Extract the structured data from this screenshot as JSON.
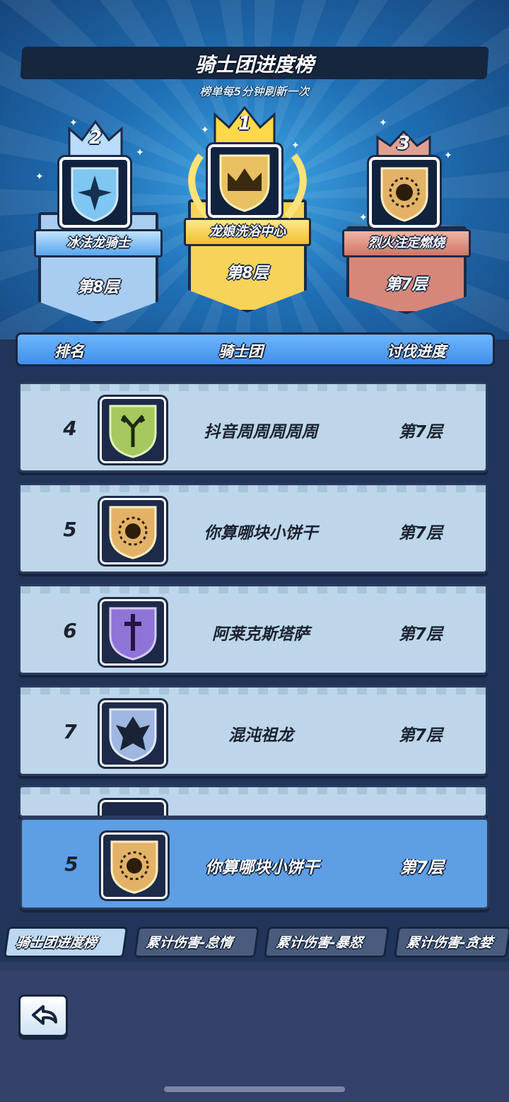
{
  "header": {
    "title": "骑士团进度榜",
    "subtitle": "榜单每5分钟刷新一次"
  },
  "podium": [
    {
      "rank": "2",
      "name": "冰法龙骑士",
      "floor": "第8层",
      "crest": "ice-star-crest-icon",
      "color": "#6aaef0"
    },
    {
      "rank": "1",
      "name": "龙娘洗浴中心",
      "floor": "第8层",
      "crest": "crown-crest-icon",
      "color": "#f6cf4e"
    },
    {
      "rank": "3",
      "name": "烈火注定燃烧",
      "floor": "第7层",
      "crest": "sun-crest-icon",
      "color": "#d8887a"
    }
  ],
  "table": {
    "columns": [
      "排名",
      "骑士团",
      "讨伐进度"
    ],
    "rows": [
      {
        "rank": "4",
        "name": "抖音周周周周周",
        "progress": "第7层",
        "crest": "stag-crest-icon"
      },
      {
        "rank": "5",
        "name": "你算哪块小饼干",
        "progress": "第7层",
        "crest": "sun-crest-icon"
      },
      {
        "rank": "6",
        "name": "阿莱克斯塔萨",
        "progress": "第7层",
        "crest": "sword-crest-icon"
      },
      {
        "rank": "7",
        "name": "混沌祖龙",
        "progress": "第7层",
        "crest": "dragon-crest-icon"
      }
    ],
    "my_row": {
      "rank": "5",
      "name": "你算哪块小饼干",
      "progress": "第7层",
      "crest": "sun-crest-icon"
    }
  },
  "tabs": [
    {
      "label": "骑士团进度榜",
      "active": true
    },
    {
      "label": "累计伤害-怠惰",
      "active": false
    },
    {
      "label": "累计伤害-暴怒",
      "active": false
    },
    {
      "label": "累计伤害-贪婪",
      "active": false
    }
  ],
  "footer": {
    "back_icon": "back-arrow-icon"
  }
}
